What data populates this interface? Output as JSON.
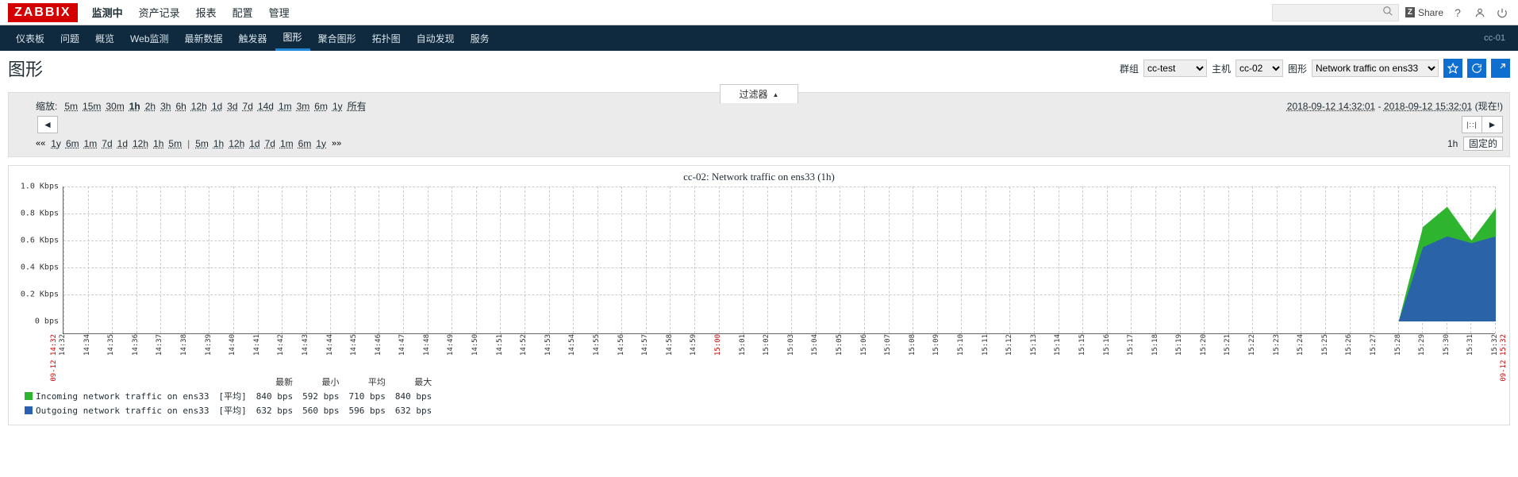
{
  "logo": "ZABBIX",
  "topnav": [
    "监测中",
    "资产记录",
    "报表",
    "配置",
    "管理"
  ],
  "topnav_active": 0,
  "share_label": "Share",
  "search_placeholder": "",
  "subnav": [
    "仪表板",
    "问题",
    "概览",
    "Web监测",
    "最新数据",
    "触发器",
    "图形",
    "聚合图形",
    "拓扑图",
    "自动发现",
    "服务"
  ],
  "subnav_active": 6,
  "host_tag": "cc-01",
  "page_title": "图形",
  "selectors": {
    "group_label": "群组",
    "group_value": "cc-test",
    "host_label": "主机",
    "host_value": "cc-02",
    "graph_label": "图形",
    "graph_value": "Network traffic on ens33"
  },
  "filter_tab": "过滤器",
  "zoom": {
    "label": "缩放:",
    "items": [
      "5m",
      "15m",
      "30m",
      "1h",
      "2h",
      "3h",
      "6h",
      "12h",
      "1d",
      "3d",
      "7d",
      "14d",
      "1m",
      "3m",
      "6m",
      "1y",
      "所有"
    ],
    "active": "1h"
  },
  "daterange": {
    "from": "2018-09-12 14:32:01",
    "to": "2018-09-12 15:32:01",
    "suffix": "(现在!)"
  },
  "shift": {
    "left": [
      "1y",
      "6m",
      "1m",
      "7d",
      "1d",
      "12h",
      "1h",
      "5m"
    ],
    "right": [
      "5m",
      "1h",
      "12h",
      "1d",
      "7d",
      "1m",
      "6m",
      "1y"
    ],
    "fixed_label": "固定的",
    "current": "1h"
  },
  "chart_title": "cc-02: Network traffic on ens33 (1h)",
  "chart_data": {
    "type": "area",
    "ylabel_unit": "Kbps",
    "ylim": [
      0,
      1.0
    ],
    "ylabels": [
      "0 bps",
      "0.2 Kbps",
      "0.4 Kbps",
      "0.6 Kbps",
      "0.8 Kbps",
      "1.0 Kbps"
    ],
    "x_categories": [
      "14:32",
      "14:34",
      "14:35",
      "14:36",
      "14:37",
      "14:38",
      "14:39",
      "14:40",
      "14:41",
      "14:42",
      "14:43",
      "14:44",
      "14:45",
      "14:46",
      "14:47",
      "14:48",
      "14:49",
      "14:50",
      "14:51",
      "14:52",
      "14:53",
      "14:54",
      "14:55",
      "14:56",
      "14:57",
      "14:58",
      "14:59",
      "15:00",
      "15:01",
      "15:02",
      "15:03",
      "15:04",
      "15:05",
      "15:06",
      "15:07",
      "15:08",
      "15:09",
      "15:10",
      "15:11",
      "15:12",
      "15:13",
      "15:14",
      "15:15",
      "15:16",
      "15:17",
      "15:18",
      "15:19",
      "15:20",
      "15:21",
      "15:22",
      "15:23",
      "15:24",
      "15:25",
      "15:26",
      "15:27",
      "15:28",
      "15:29",
      "15:30",
      "15:31",
      "15:32"
    ],
    "x_hour_index": 27,
    "x_edge_labels": {
      "start": "09-12 14:32",
      "end": "09-12 15:32"
    },
    "series": [
      {
        "name": "Incoming network traffic on ens33",
        "color": "#2fb42f",
        "values": [
          0,
          0,
          0,
          0,
          0,
          0,
          0,
          0,
          0,
          0,
          0,
          0,
          0,
          0,
          0,
          0,
          0,
          0,
          0,
          0,
          0,
          0,
          0,
          0,
          0,
          0,
          0,
          0,
          0,
          0,
          0,
          0,
          0,
          0,
          0,
          0,
          0,
          0,
          0,
          0,
          0,
          0,
          0,
          0,
          0,
          0,
          0,
          0,
          0,
          0,
          0,
          0,
          0,
          0,
          0,
          0,
          0.7,
          0.85,
          0.6,
          0.84
        ]
      },
      {
        "name": "Outgoing network traffic on ens33",
        "color": "#2b5fb0",
        "values": [
          0,
          0,
          0,
          0,
          0,
          0,
          0,
          0,
          0,
          0,
          0,
          0,
          0,
          0,
          0,
          0,
          0,
          0,
          0,
          0,
          0,
          0,
          0,
          0,
          0,
          0,
          0,
          0,
          0,
          0,
          0,
          0,
          0,
          0,
          0,
          0,
          0,
          0,
          0,
          0,
          0,
          0,
          0,
          0,
          0,
          0,
          0,
          0,
          0,
          0,
          0,
          0,
          0,
          0,
          0,
          0,
          0.55,
          0.63,
          0.58,
          0.63
        ]
      }
    ]
  },
  "legend": {
    "agg_label": "[平均]",
    "headers": [
      "最新",
      "最小",
      "平均",
      "最大"
    ],
    "rows": [
      {
        "name": "Incoming network traffic on ens33",
        "color": "#2fb42f",
        "vals": [
          "840 bps",
          "592 bps",
          "710 bps",
          "840 bps"
        ]
      },
      {
        "name": "Outgoing network traffic on ens33",
        "color": "#2b5fb0",
        "vals": [
          "632 bps",
          "560 bps",
          "596 bps",
          "632 bps"
        ]
      }
    ]
  }
}
